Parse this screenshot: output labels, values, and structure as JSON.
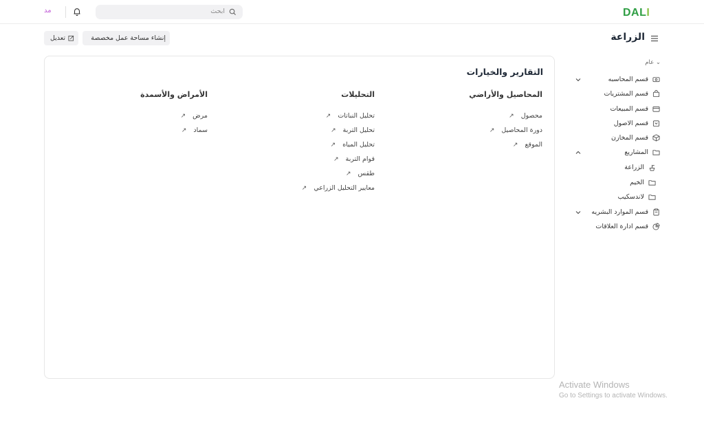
{
  "header": {
    "logo_main": "DAL",
    "logo_accent": "I",
    "search_placeholder": "ابحث",
    "avatar_initials": "مد"
  },
  "page": {
    "title": "الزراعة",
    "create_workspace_label": "إنشاء مساحة عمل مخصصة",
    "edit_label": "تعديل"
  },
  "card": {
    "title": "التقارير والخيارات",
    "columns": [
      {
        "heading": "المحاصيل والأراضي",
        "links": [
          "محصول",
          "دورة المحاصيل",
          "الموقع"
        ]
      },
      {
        "heading": "التحليلات",
        "links": [
          "تحليل النباتات",
          "تحليل التربة",
          "تحليل المياه",
          "قوام التربة",
          "طقس",
          "معايير التحليل الزراعي"
        ]
      },
      {
        "heading": "الأمراض والأسمدة",
        "links": [
          "مرض",
          "سماد"
        ]
      }
    ]
  },
  "sidebar": {
    "section_label": "عام",
    "items": [
      {
        "label": "قسم المحاسبه",
        "icon": "cash-icon",
        "chevron": "down"
      },
      {
        "label": "قسم المشتريات",
        "icon": "bag-icon"
      },
      {
        "label": "قسم المبيعات",
        "icon": "card-icon"
      },
      {
        "label": "قسم الاصول",
        "icon": "box-icon"
      },
      {
        "label": "قسم المخازن",
        "icon": "cube-icon"
      },
      {
        "label": "المشاريع",
        "icon": "folder-icon",
        "chevron": "up"
      },
      {
        "label": "الزراعة",
        "icon": "plant-icon"
      },
      {
        "label": "الخيم",
        "icon": "folder-icon"
      },
      {
        "label": "لاندسكيب",
        "icon": "folder-icon"
      },
      {
        "label": "قسم الموارد البشريه",
        "icon": "clipboard-icon",
        "chevron": "down"
      },
      {
        "label": "قسم ادارة العلاقات",
        "icon": "pie-icon"
      }
    ]
  },
  "watermark": {
    "line1": "Activate Windows",
    "line2": "Go to Settings to activate Windows."
  },
  "colors": {
    "brand_green": "#2f9e44",
    "brand_light_green": "#8bc34a",
    "avatar_purple": "#c05ad6"
  }
}
